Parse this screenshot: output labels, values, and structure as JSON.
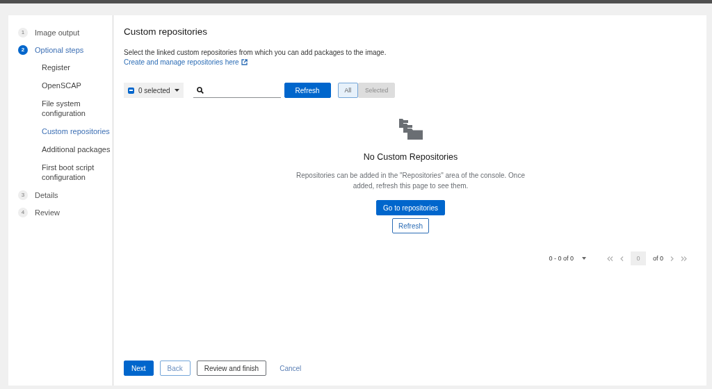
{
  "nav": [
    {
      "number": "1",
      "label": "Image output",
      "selected": false
    },
    {
      "number": "2",
      "label": "Optional steps",
      "selected": true,
      "children": [
        {
          "label": "Register",
          "selected": false
        },
        {
          "label": "OpenSCAP",
          "selected": false
        },
        {
          "label": "File system configuration",
          "selected": false
        },
        {
          "label": "Custom repositories",
          "selected": true
        },
        {
          "label": "Additional packages",
          "selected": false
        },
        {
          "label": "First boot script configuration",
          "selected": false
        }
      ]
    },
    {
      "number": "3",
      "label": "Details",
      "selected": false
    },
    {
      "number": "4",
      "label": "Review",
      "selected": false
    }
  ],
  "title": "Custom repositories",
  "description": "Select the linked custom repositories from which you can add packages to the image.",
  "manage_link": "Create and manage repositories here",
  "toolbar": {
    "bulk_select": {
      "label": "0 selected",
      "indeterminate": true
    },
    "refresh": "Refresh",
    "toggle": [
      {
        "label": "All",
        "selected": true
      },
      {
        "label": "Selected",
        "selected": false
      }
    ]
  },
  "empty_state": {
    "title": "No Custom Repositories",
    "body": "Repositories can be added in the \"Repositories\" area of the console. Once added, refresh this page to see them.",
    "primary": "Go to repositories",
    "secondary": "Refresh"
  },
  "pagination": {
    "range": "0 - 0 of 0",
    "page": "0",
    "of_pages": "of 0"
  },
  "footer": {
    "next": "Next",
    "back": "Back",
    "review": "Review and finish",
    "cancel": "Cancel"
  }
}
